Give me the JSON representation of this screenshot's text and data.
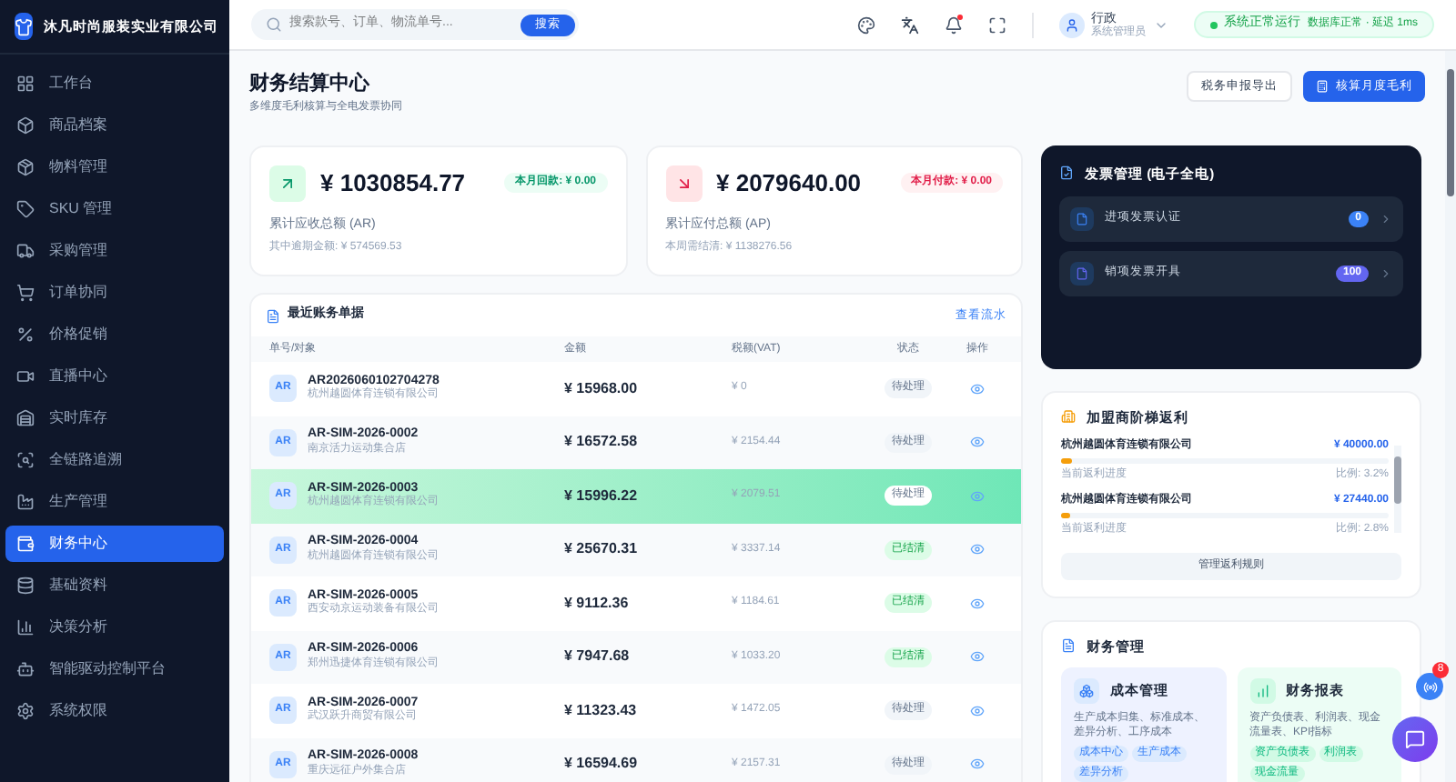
{
  "company": "沐凡时尚服装实业有限公司",
  "sidebar": {
    "items": [
      {
        "label": "工作台",
        "selected": false
      },
      {
        "label": "商品档案",
        "selected": false
      },
      {
        "label": "物料管理",
        "selected": false
      },
      {
        "label": "SKU 管理",
        "selected": false
      },
      {
        "label": "采购管理",
        "selected": false
      },
      {
        "label": "订单协同",
        "selected": false
      },
      {
        "label": "价格促销",
        "selected": false
      },
      {
        "label": "直播中心",
        "selected": false
      },
      {
        "label": "实时库存",
        "selected": false
      },
      {
        "label": "全链路追溯",
        "selected": false
      },
      {
        "label": "生产管理",
        "selected": false
      },
      {
        "label": "财务中心",
        "selected": true
      },
      {
        "label": "基础资料",
        "selected": false
      },
      {
        "label": "决策分析",
        "selected": false
      },
      {
        "label": "智能驱动控制平台",
        "selected": false
      },
      {
        "label": "系统权限",
        "selected": false
      }
    ]
  },
  "header": {
    "search": {
      "placeholder": "搜索款号、订单、物流单号...",
      "button": "搜索"
    },
    "user": {
      "name": "行政",
      "role": "系统管理员"
    },
    "status": {
      "label": "系统正常运行",
      "detail": "数据库正常 · 延迟 1ms"
    }
  },
  "page": {
    "title": "财务结算中心",
    "subtitle": "多维度毛利核算与全电发票协同",
    "buttons": [
      {
        "label": "税务申报导出",
        "kind": "secondary"
      },
      {
        "label": "核算月度毛利",
        "kind": "primary"
      }
    ]
  },
  "summary_cards": [
    {
      "kind": "ar",
      "amount": "¥ 1030854.77",
      "badge": "本月回款: ¥ 0.00",
      "label": "累计应收总额 (AR)",
      "note": "其中逾期金额: ¥ 574569.53"
    },
    {
      "kind": "ap",
      "amount": "¥ 2079640.00",
      "badge": "本月付款: ¥ 0.00",
      "label": "累计应付总额 (AP)",
      "note": "本周需结清: ¥ 1138276.56"
    }
  ],
  "table": {
    "title": "最近账务单据",
    "link": "查看流水",
    "columns": [
      "单号/对象",
      "金额",
      "税额(VAT)",
      "状态",
      "操作"
    ],
    "rows": [
      {
        "tag": "AR",
        "id": "AR2026060102704278",
        "party": "杭州越圆体育连锁有限公司",
        "amount": "¥ 15968.00",
        "vat": "¥ 0",
        "status": "待处理",
        "settled": false,
        "selected": false
      },
      {
        "tag": "AR",
        "id": "AR-SIM-2026-0002",
        "party": "南京活力运动集合店",
        "amount": "¥ 16572.58",
        "vat": "¥ 2154.44",
        "status": "待处理",
        "settled": false,
        "selected": false
      },
      {
        "tag": "AR",
        "id": "AR-SIM-2026-0003",
        "party": "杭州越圆体育连锁有限公司",
        "amount": "¥ 15996.22",
        "vat": "¥ 2079.51",
        "status": "待处理",
        "settled": false,
        "selected": true
      },
      {
        "tag": "AR",
        "id": "AR-SIM-2026-0004",
        "party": "杭州越圆体育连锁有限公司",
        "amount": "¥ 25670.31",
        "vat": "¥ 3337.14",
        "status": "已结清",
        "settled": true,
        "selected": false
      },
      {
        "tag": "AR",
        "id": "AR-SIM-2026-0005",
        "party": "西安动京运动装备有限公司",
        "amount": "¥ 9112.36",
        "vat": "¥ 1184.61",
        "status": "已结清",
        "settled": true,
        "selected": false
      },
      {
        "tag": "AR",
        "id": "AR-SIM-2026-0006",
        "party": "郑州迅捷体育连锁有限公司",
        "amount": "¥ 7947.68",
        "vat": "¥ 1033.20",
        "status": "已结清",
        "settled": true,
        "selected": false
      },
      {
        "tag": "AR",
        "id": "AR-SIM-2026-0007",
        "party": "武汉跃升商贸有限公司",
        "amount": "¥ 11323.43",
        "vat": "¥ 1472.05",
        "status": "待处理",
        "settled": false,
        "selected": false
      },
      {
        "tag": "AR",
        "id": "AR-SIM-2026-0008",
        "party": "重庆远征户外集合店",
        "amount": "¥ 16594.69",
        "vat": "¥ 2157.31",
        "status": "待处理",
        "settled": false,
        "selected": false
      }
    ]
  },
  "invoice_panel": {
    "title": "发票管理 (电子全电)",
    "items": [
      {
        "label": "进项发票认证",
        "count": "0",
        "color": "#3b82f6"
      },
      {
        "label": "销项发票开具",
        "count": "100",
        "color": "#6366f1"
      }
    ]
  },
  "rebate_panel": {
    "title": "加盟商阶梯返利",
    "items": [
      {
        "name": "杭州越圆体育连锁有限公司",
        "amount": "¥ 40000.00",
        "caption": "当前返利进度",
        "ratio": "比例: 3.2%",
        "level": 0.032
      },
      {
        "name": "杭州越圆体育连锁有限公司",
        "amount": "¥ 27440.00",
        "caption": "当前返利进度",
        "ratio": "比例: 2.8%",
        "level": 0.028
      }
    ],
    "button": "管理返利规则"
  },
  "finance_panel": {
    "title": "财务管理",
    "modules": [
      {
        "kind": "cost",
        "title": "成本管理",
        "desc": "生产成本归集、标准成本、差异分析、工序成本",
        "tags": [
          "成本中心",
          "生产成本",
          "差异分析"
        ]
      },
      {
        "kind": "report",
        "title": "财务报表",
        "desc": "资产负债表、利润表、现金流量表、KPI指标",
        "tags": [
          "资产负债表",
          "利润表",
          "现金流量"
        ]
      }
    ]
  },
  "float_badge": "8"
}
